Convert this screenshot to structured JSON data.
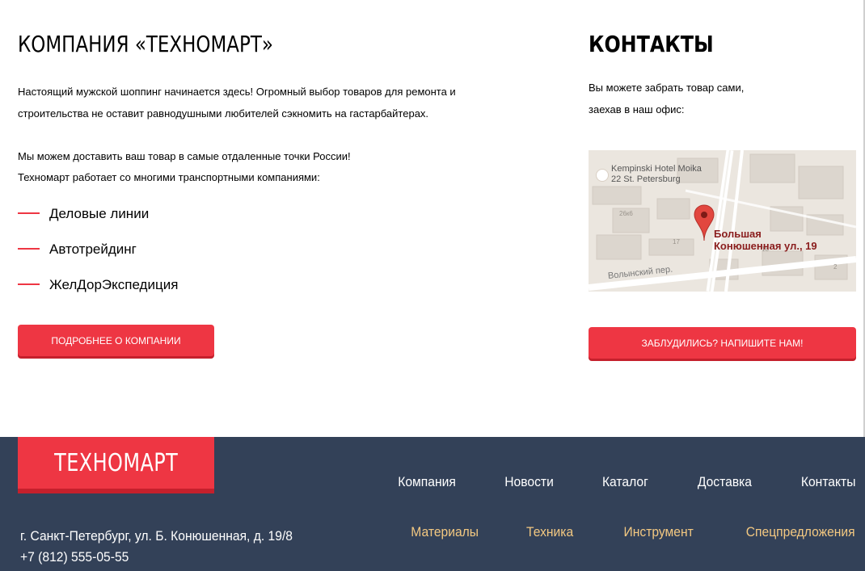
{
  "about": {
    "title": "КОМПАНИЯ «ТЕХНОМАРТ»",
    "intro": "Настоящий мужской шоппинг начинается здесь! Огромный выбор товаров для ремонта и строительства не оставит равнодушными любителей сэкномить на гастарбайтерах.",
    "delivery_line1": "Мы можем доставить ваш товар в самые отдаленные точки России!",
    "delivery_line2": "Техномарт работает со многими транспортными компаниями:",
    "partners": [
      "Деловые линии",
      "Автотрейдинг",
      "ЖелДорЭкспедиция"
    ],
    "button_label": "Подробнее о компании"
  },
  "contacts": {
    "title": "КОНТАКТЫ",
    "text_line1": "Вы можете забрать товар сами,",
    "text_line2": "заехав в наш офис:",
    "map": {
      "hotel_line1": "Kempinski Hotel Moika",
      "hotel_line2": "22 St. Petersburg",
      "address_line1": "Большая",
      "address_line2": "Конюшенная ул., 19",
      "street": "Волынский пер.",
      "building_numbers": [
        "26к6",
        "17",
        "18",
        "2"
      ],
      "pin_color": "#e2473f",
      "hotel_icon": "hotel-bed-icon"
    },
    "button_label": "Заблудились? Напишите нам!"
  },
  "footer": {
    "logo": "ТЕХНОМАРТ",
    "address_line1": "г. Санкт-Петербург, ул. Б. Конюшенная, д. 19/8",
    "phone": "+7 (812) 555-05-55",
    "nav_main": [
      "Компания",
      "Новости",
      "Каталог",
      "Доставка",
      "Контакты"
    ],
    "nav_sub": [
      "Материалы",
      "Техника",
      "Инструмент",
      "Спецпредложения"
    ]
  },
  "colors": {
    "accent": "#ee3643",
    "accent_shadow": "#c5202c",
    "footer_bg": "#334158",
    "footer_sub_link": "#f3c881"
  }
}
